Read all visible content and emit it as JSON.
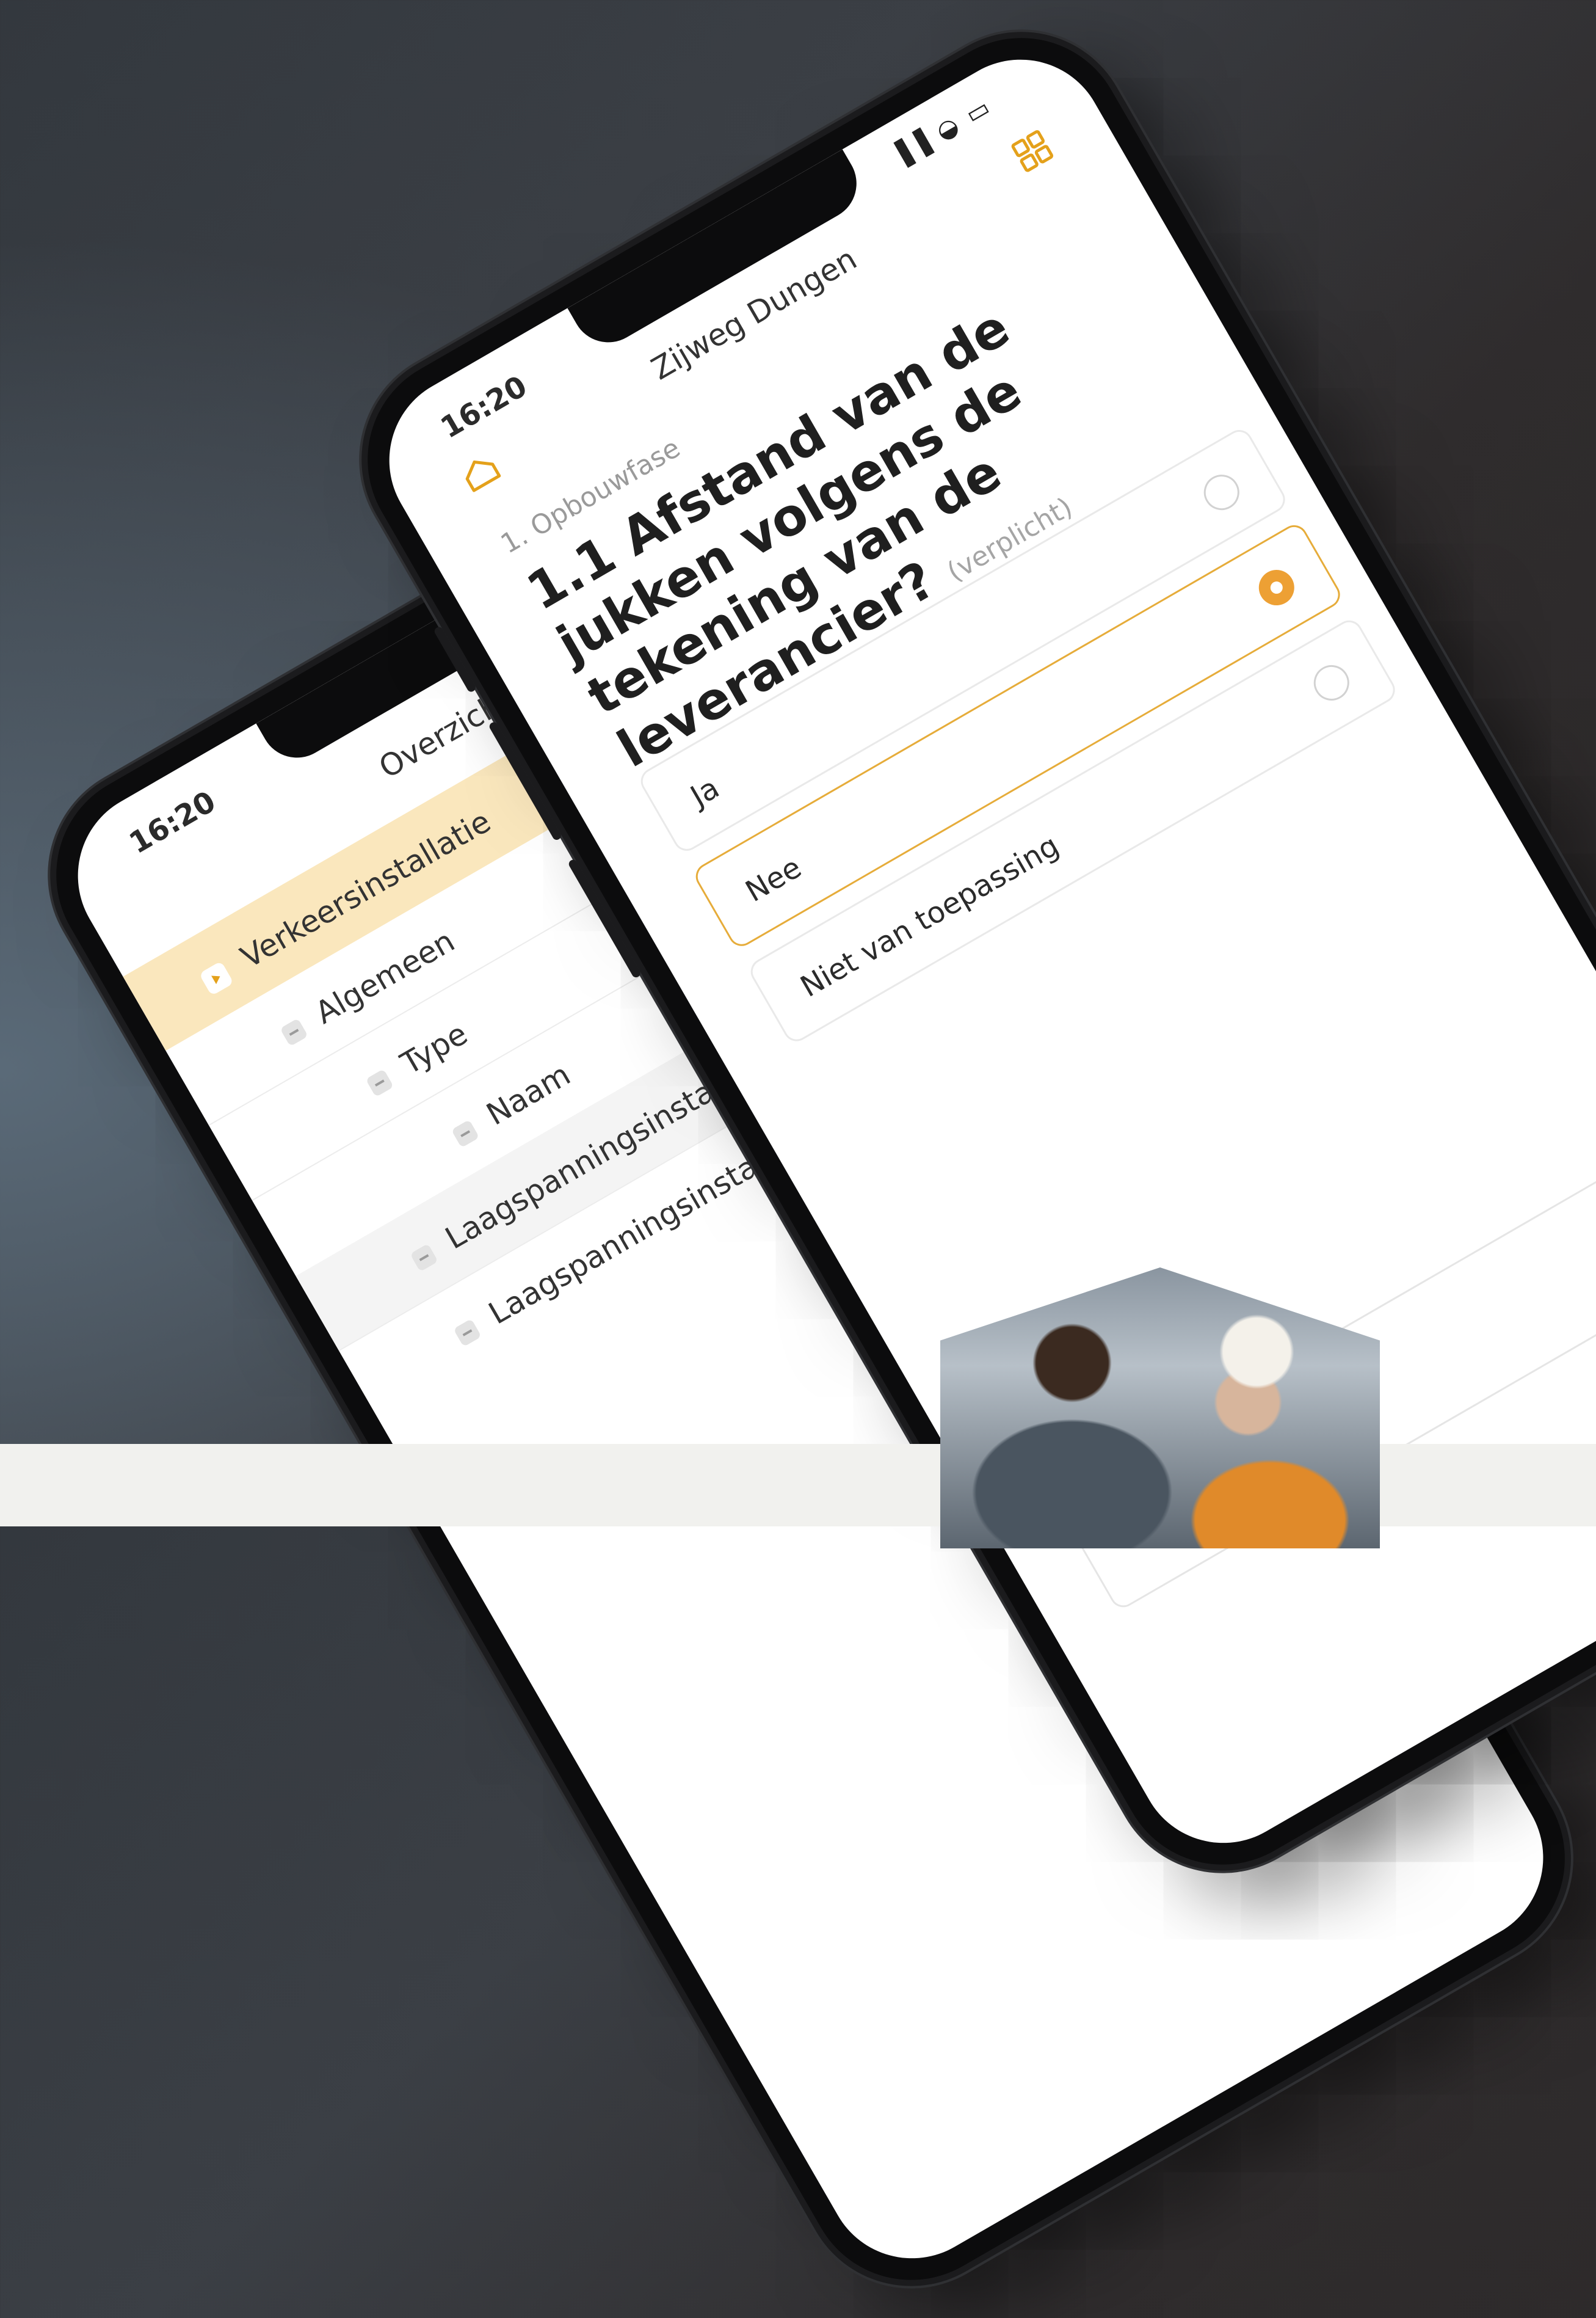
{
  "front_phone": {
    "status_time": "16:20",
    "status_icons": "▐▐ ◒ ▭",
    "title": "Zijweg Dungen",
    "breadcrumb": "1. Opbouwfase",
    "question": "1.1 Afstand van de jukken volgens de tekening van de leverancier?",
    "required_label": "(verplicht)",
    "options": [
      {
        "label": "Ja",
        "selected": false
      },
      {
        "label": "Nee",
        "selected": true
      },
      {
        "label": "Niet van toepassing",
        "selected": false
      }
    ],
    "colors": {
      "accent": "#e4a11b",
      "selected_radio": "#eda034"
    }
  },
  "back_phone": {
    "status_time": "16:20",
    "title": "Overzicht",
    "tree": [
      {
        "label": "Verkeersinstallatie",
        "active": true
      },
      {
        "label": "Algemeen"
      },
      {
        "label": "Type"
      },
      {
        "label": "Naam"
      },
      {
        "label": "Laagspanningsinstallatie 1"
      },
      {
        "label": "Laagspanningsinstallatie 2"
      }
    ],
    "colors": {
      "active_row": "#fae7bd"
    }
  }
}
